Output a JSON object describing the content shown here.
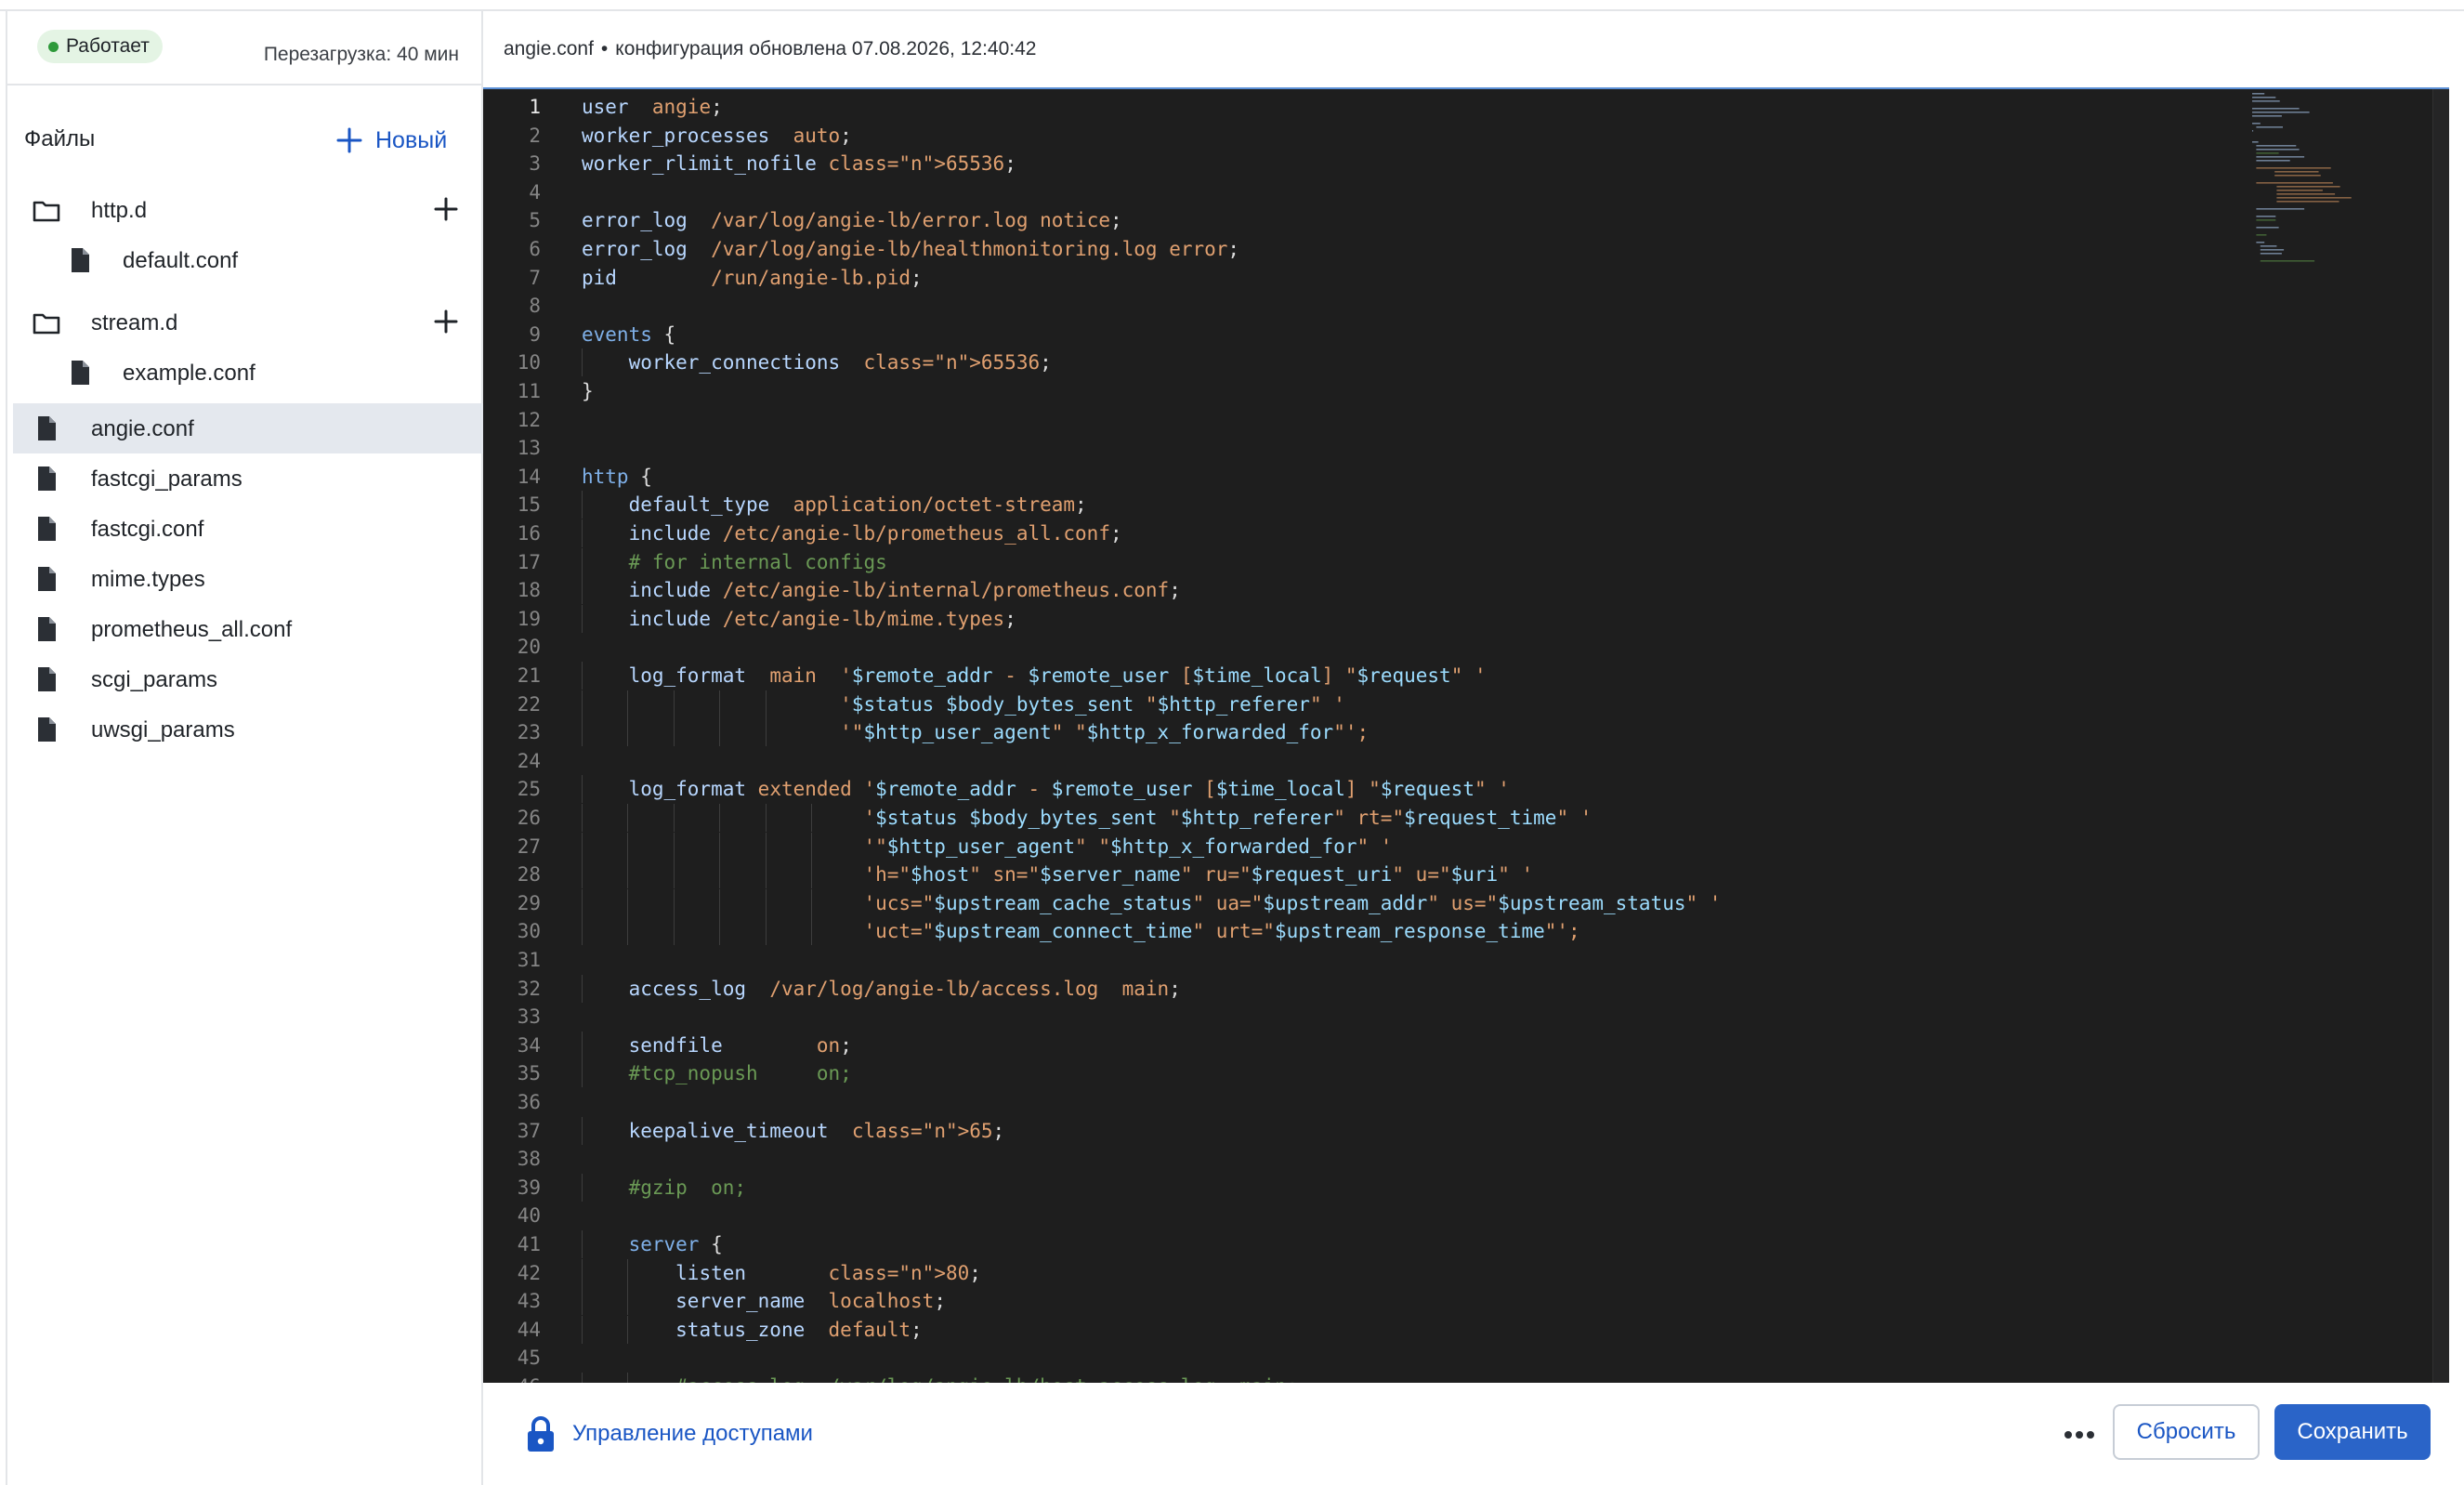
{
  "status": {
    "badge": "Работает",
    "restart": "Перезагрузка: 40 мин",
    "color": "#2e9a3a"
  },
  "sidebar": {
    "title": "Файлы",
    "new_label": "Новый",
    "tree": [
      {
        "type": "folder",
        "label": "http.d",
        "icon": "folder-icon",
        "level": 0
      },
      {
        "type": "file",
        "label": "default.conf",
        "icon": "file-icon",
        "level": 1
      },
      {
        "type": "folder",
        "label": "stream.d",
        "icon": "folder-icon",
        "level": 0
      },
      {
        "type": "file",
        "label": "example.conf",
        "icon": "file-icon",
        "level": 1
      },
      {
        "type": "file",
        "label": "angie.conf",
        "icon": "file-icon",
        "level": 0,
        "selected": true
      },
      {
        "type": "file",
        "label": "fastcgi_params",
        "icon": "file-icon",
        "level": 0
      },
      {
        "type": "file",
        "label": "fastcgi.conf",
        "icon": "file-icon",
        "level": 0
      },
      {
        "type": "file",
        "label": "mime.types",
        "icon": "file-icon",
        "level": 0
      },
      {
        "type": "file",
        "label": "prometheus_all.conf",
        "icon": "file-icon",
        "level": 0
      },
      {
        "type": "file",
        "label": "scgi_params",
        "icon": "file-icon",
        "level": 0
      },
      {
        "type": "file",
        "label": "uwsgi_params",
        "icon": "file-icon",
        "level": 0
      }
    ]
  },
  "header": {
    "filename": "angie.conf",
    "separator": "•",
    "updated": "конфигурация обновлена 07.08.2026, 12:40:42"
  },
  "editor": {
    "active_line": 1,
    "lines": [
      "user  angie;",
      "worker_processes  auto;",
      "worker_rlimit_nofile 65536;",
      "",
      "error_log  /var/log/angie-lb/error.log notice;",
      "error_log  /var/log/angie-lb/healthmonitoring.log error;",
      "pid        /run/angie-lb.pid;",
      "",
      "events {",
      "    worker_connections  65536;",
      "}",
      "",
      "",
      "http {",
      "    default_type  application/octet-stream;",
      "    include /etc/angie-lb/prometheus_all.conf;",
      "    # for internal configs",
      "    include /etc/angie-lb/internal/prometheus.conf;",
      "    include /etc/angie-lb/mime.types;",
      "",
      "    log_format  main  '$remote_addr - $remote_user [$time_local] \"$request\" '",
      "                      '$status $body_bytes_sent \"$http_referer\" '",
      "                      '\"$http_user_agent\" \"$http_x_forwarded_for\"';",
      "",
      "    log_format extended '$remote_addr - $remote_user [$time_local] \"$request\" '",
      "                        '$status $body_bytes_sent \"$http_referer\" rt=\"$request_time\" '",
      "                        '\"$http_user_agent\" \"$http_x_forwarded_for\" '",
      "                        'h=\"$host\" sn=\"$server_name\" ru=\"$request_uri\" u=\"$uri\" '",
      "                        'ucs=\"$upstream_cache_status\" ua=\"$upstream_addr\" us=\"$upstream_status\" '",
      "                        'uct=\"$upstream_connect_time\" urt=\"$upstream_response_time\"';",
      "",
      "    access_log  /var/log/angie-lb/access.log  main;",
      "",
      "    sendfile        on;",
      "    #tcp_nopush     on;",
      "",
      "    keepalive_timeout  65;",
      "",
      "    #gzip  on;",
      "",
      "    server {",
      "        listen       80;",
      "        server_name  localhost;",
      "        status_zone  default;",
      "",
      "        #access_log  /var/log/angie-lb/host.access.log  main;"
    ]
  },
  "footer": {
    "access_label": "Управление доступами",
    "more_label": "•••",
    "reset_label": "Сбросить",
    "save_label": "Сохранить"
  },
  "colors": {
    "accent": "#2a64c8",
    "link": "#1a56c4",
    "editor_bg": "#1e1e1e",
    "selected_row": "#e4e8ee"
  }
}
